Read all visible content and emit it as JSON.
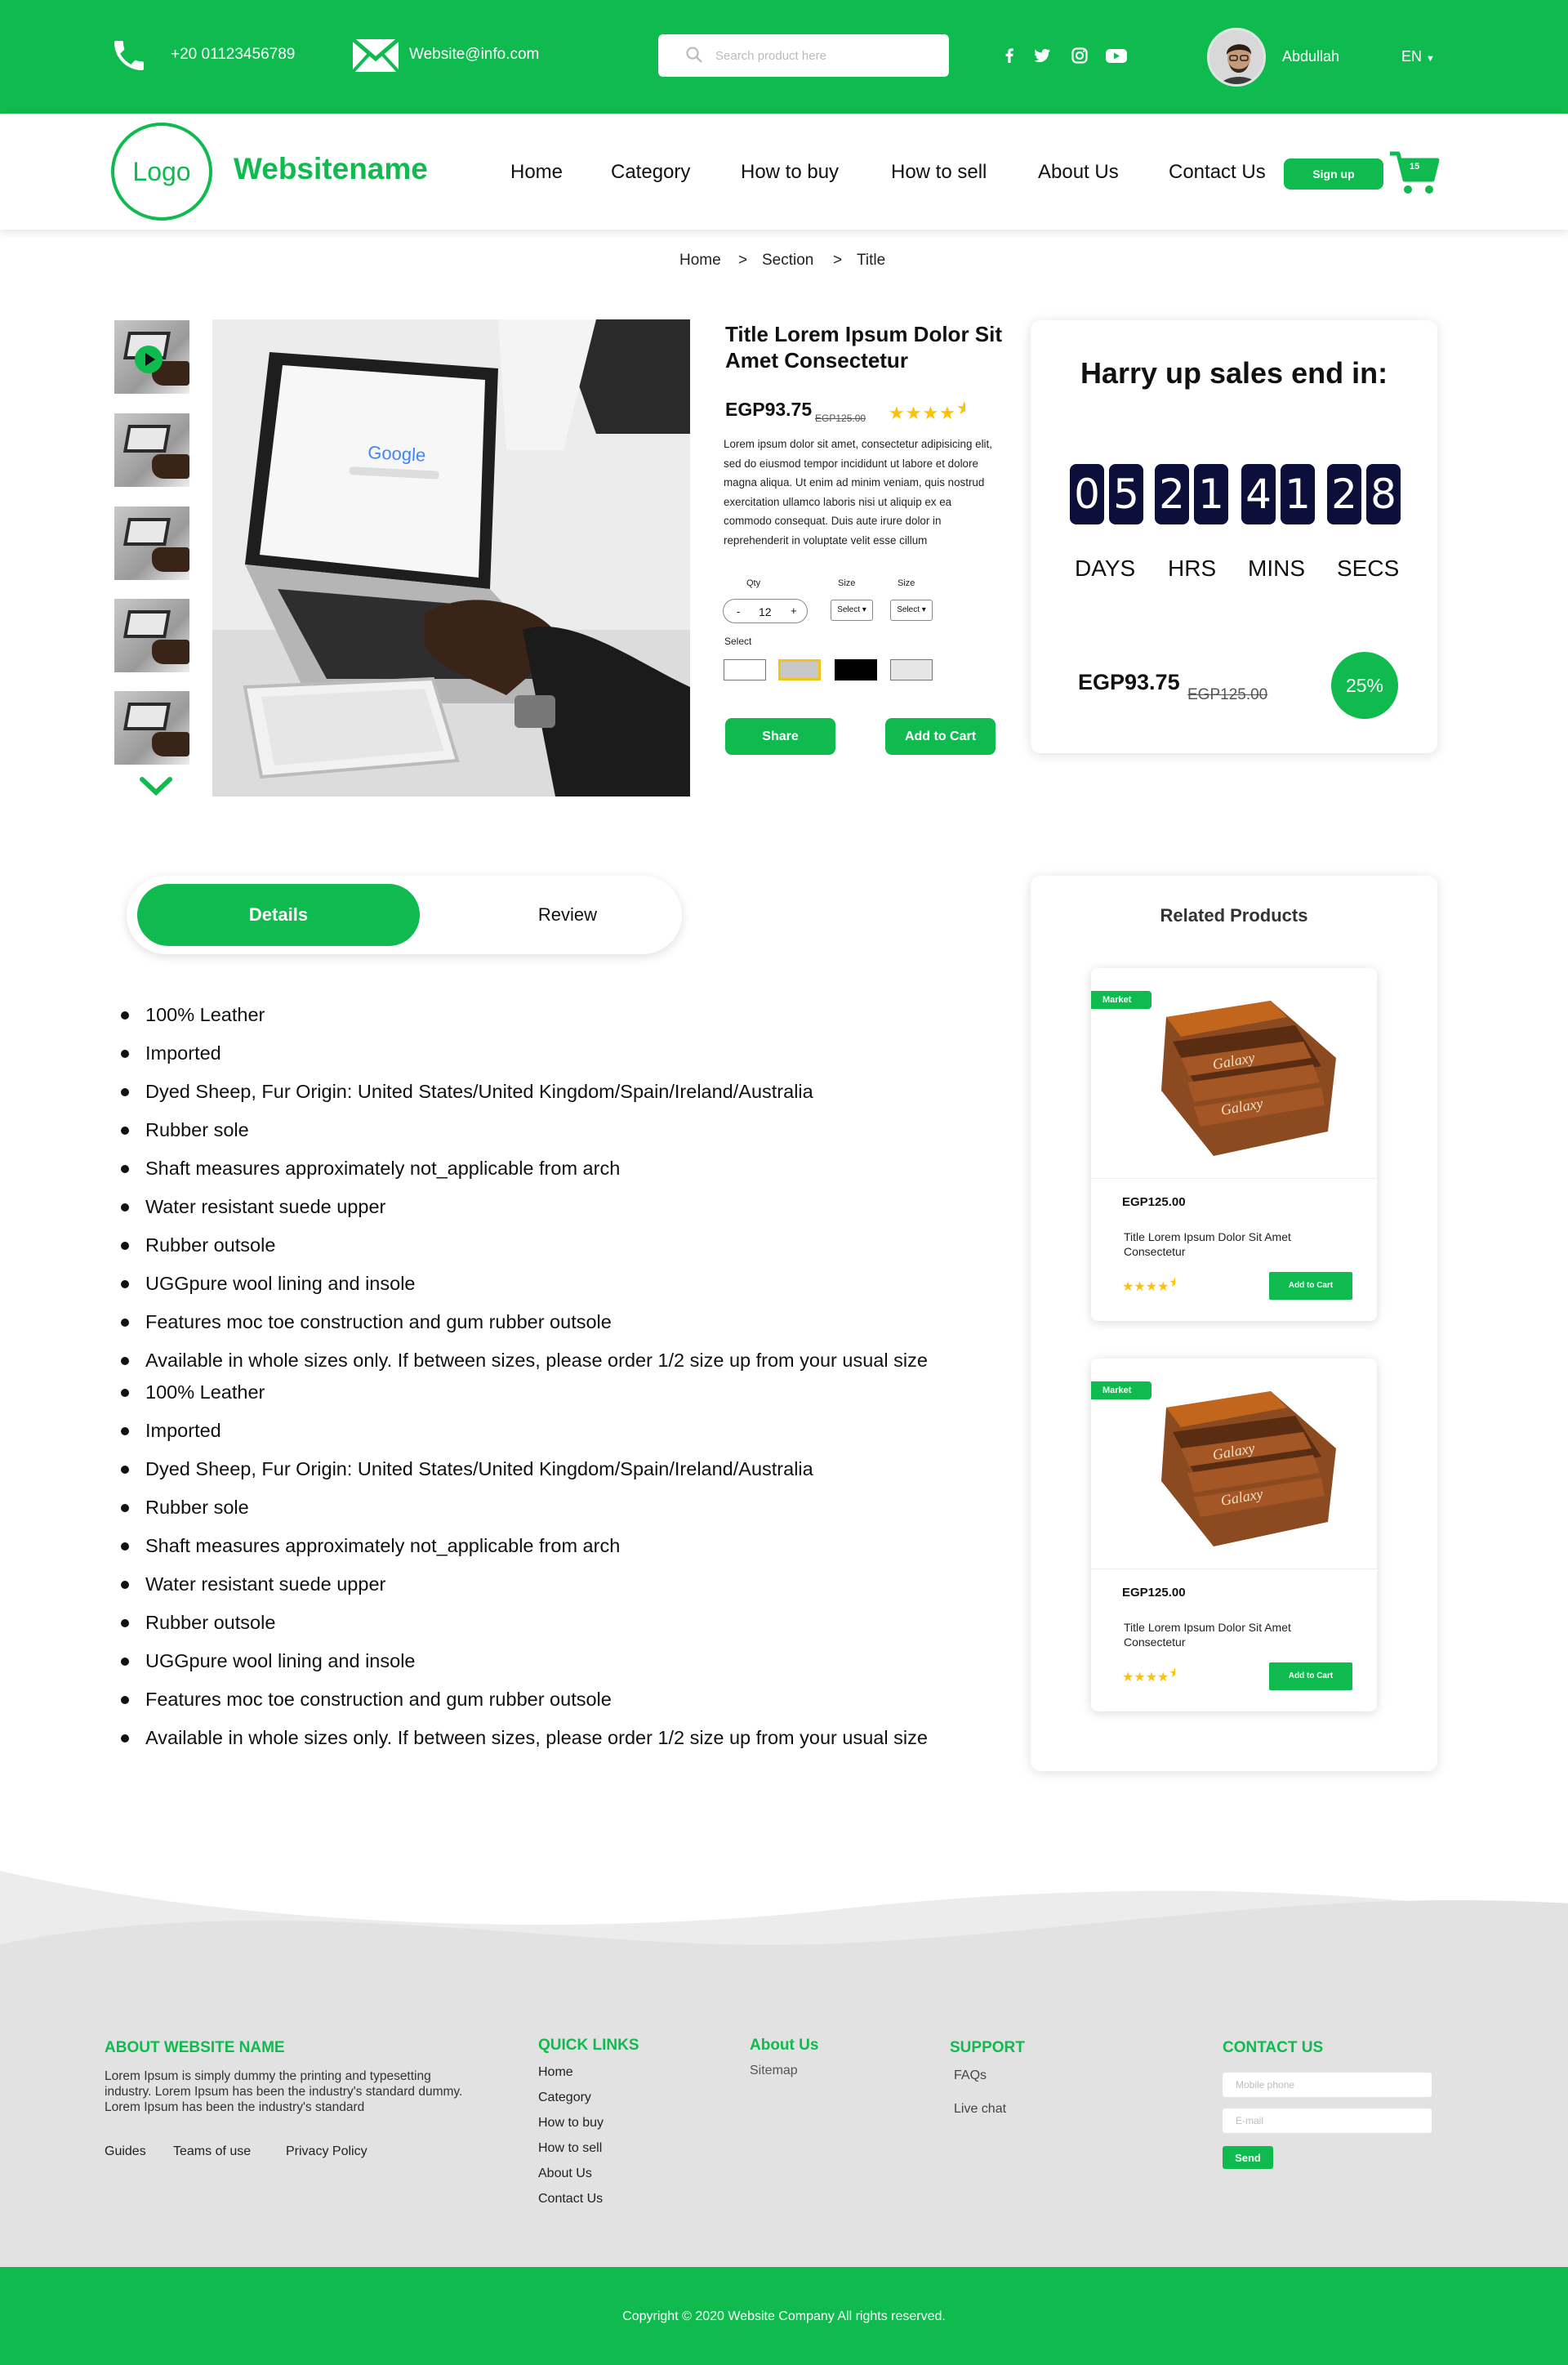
{
  "colors": {
    "brand": "#0fba4e",
    "countdown_digit_bg": "#0b0f3a",
    "star": "#ffc107",
    "footer_bg": "#e6e6e6"
  },
  "topbar": {
    "phone": "+20 01123456789",
    "email": "Website@info.com",
    "search_placeholder": "Search product here",
    "social_icons": [
      "facebook-icon",
      "twitter-icon",
      "instagram-icon",
      "youtube-icon"
    ],
    "user_name": "Abdullah",
    "language": "EN"
  },
  "nav": {
    "logo": "Logo",
    "site_name": "Websitename",
    "links": [
      "Home",
      "Category",
      "How to buy",
      "How to sell",
      "About Us",
      "Contact Us"
    ],
    "signup": "Sign up",
    "cart_count": "15"
  },
  "breadcrumb": {
    "items": [
      "Home",
      "Section",
      "Title"
    ],
    "separator": ">"
  },
  "product": {
    "title": "Title Lorem Ipsum Dolor Sit Amet Consectetur",
    "price": "EGP93.75",
    "old_price": "EGP125.00",
    "rating": 4.5,
    "description": "Lorem ipsum dolor sit amet, consectetur adipisicing elit, sed do eiusmod tempor incididunt ut labore et dolore magna aliqua. Ut enim ad minim veniam, quis nostrud exercitation ullamco laboris nisi ut aliquip ex ea commodo consequat. Duis aute irure dolor in reprehenderit in voluptate velit esse cillum",
    "qty_label": "Qty",
    "qty_minus": "-",
    "qty_value": "12",
    "qty_plus": "+",
    "size_label_1": "Size",
    "size_label_2": "Size",
    "size_select_1": "Select",
    "size_select_2": "Select",
    "color_label": "Select",
    "swatches": [
      "#ffffff",
      "#c8c8c8",
      "#000000",
      "#e6e6e6"
    ],
    "share": "Share",
    "add_to_cart": "Add to Cart"
  },
  "countdown": {
    "title": "Harry up sales end in:",
    "digits": {
      "days": [
        "0",
        "5"
      ],
      "hrs": [
        "2",
        "1"
      ],
      "mins": [
        "4",
        "1"
      ],
      "secs": [
        "2",
        "8"
      ]
    },
    "units": [
      "DAYS",
      "HRS",
      "MINS",
      "SECS"
    ],
    "price": "EGP93.75",
    "old_price": "EGP125.00",
    "discount": "25%"
  },
  "tabs": {
    "details": "Details",
    "review": "Review"
  },
  "features": [
    "100% Leather",
    "Imported",
    "Dyed Sheep, Fur Origin: United States/United Kingdom/Spain/Ireland/Australia",
    "Rubber sole",
    "Shaft measures approximately not_applicable from arch",
    "Water resistant suede upper",
    "Rubber outsole",
    "UGGpure wool lining and insole",
    "Features moc toe construction and gum rubber outsole",
    "Available in whole sizes only. If between sizes, please order 1/2 size up from your usual size",
    "100% Leather",
    "Imported",
    "Dyed Sheep, Fur Origin: United States/United Kingdom/Spain/Ireland/Australia",
    "Rubber sole",
    "Shaft measures approximately not_applicable from arch",
    "Water resistant suede upper",
    "Rubber outsole",
    "UGGpure wool lining and insole",
    "Features moc toe construction and gum rubber outsole",
    "Available in whole sizes only. If between sizes, please order 1/2 size up from your usual size"
  ],
  "related": {
    "title": "Related Products",
    "items": [
      {
        "badge": "Market",
        "price": "EGP125.00",
        "title": "Title Lorem Ipsum Dolor Sit Amet Consectetur",
        "rating": 4.5,
        "button": "Add to Cart",
        "brand_on_image": "Galaxy"
      },
      {
        "badge": "Market",
        "price": "EGP125.00",
        "title": "Title Lorem Ipsum Dolor Sit Amet Consectetur",
        "rating": 4.5,
        "button": "Add to Cart",
        "brand_on_image": "Galaxy"
      }
    ]
  },
  "footer": {
    "about_title": "ABOUT WEBSITE NAME",
    "about_text": "Lorem Ipsum is simply dummy the printing and typesetting industry. Lorem Ipsum has been the industry's standard dummy. Lorem Ipsum has been the industry's standard",
    "bottom_links": [
      "Guides",
      "Teams of use",
      "Privacy Policy"
    ],
    "quick_links_title": "QUICK LINKS",
    "quick_links": [
      "Home",
      "Category",
      "How to buy",
      "How to sell",
      "About Us",
      "Contact Us"
    ],
    "about_us_title": "About Us",
    "about_us_links": [
      "Sitemap"
    ],
    "support_title": "SUPPORT",
    "support_links": [
      "FAQs",
      "Live chat"
    ],
    "contact_title": "CONTACT US",
    "mobile_placeholder": "Mobile phone",
    "email_placeholder": "E-mail",
    "send": "Send",
    "copyright": "Copyright © 2020 Website Company All rights reserved."
  }
}
